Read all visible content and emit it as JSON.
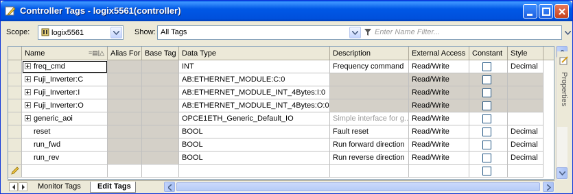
{
  "window": {
    "title": "Controller Tags - logix5561(controller)"
  },
  "toolbar": {
    "scope_label": "Scope:",
    "scope_value": "logix5561",
    "show_label": "Show:",
    "show_value": "All Tags",
    "filter_placeholder": "Enter Name Filter..."
  },
  "table": {
    "columns": [
      "Name",
      "Alias For",
      "Base Tag",
      "Data Type",
      "Description",
      "External Access",
      "Constant",
      "Style"
    ],
    "rows": [
      {
        "name": "freq_cmd",
        "expandable": true,
        "alias_for": "",
        "base_tag": "",
        "data_type": "INT",
        "description": "Frequency command",
        "external_access": "Read/Write",
        "constant": false,
        "style": "Decimal",
        "greyed": false
      },
      {
        "name": "Fuji_Inverter:C",
        "expandable": true,
        "alias_for": "",
        "base_tag": "",
        "data_type": "AB:ETHERNET_MODULE:C:0",
        "description": "",
        "external_access": "Read/Write",
        "constant": false,
        "style": "",
        "greyed": true
      },
      {
        "name": "Fuji_Inverter:I",
        "expandable": true,
        "alias_for": "",
        "base_tag": "",
        "data_type": "AB:ETHERNET_MODULE_INT_4Bytes:I:0",
        "description": "",
        "external_access": "Read/Write",
        "constant": false,
        "style": "",
        "greyed": true
      },
      {
        "name": "Fuji_Inverter:O",
        "expandable": true,
        "alias_for": "",
        "base_tag": "",
        "data_type": "AB:ETHERNET_MODULE_INT_4Bytes:O:0",
        "description": "",
        "external_access": "Read/Write",
        "constant": false,
        "style": "",
        "greyed": true
      },
      {
        "name": "generic_aoi",
        "expandable": true,
        "alias_for": "",
        "base_tag": "",
        "data_type": "OPCE1ETH_Generic_Default_IO",
        "description": "Simple interface for g...",
        "description_muted": true,
        "external_access": "Read/Write",
        "constant": false,
        "style": "",
        "greyed": false
      },
      {
        "name": "reset",
        "expandable": false,
        "alias_for": "",
        "base_tag": "",
        "data_type": "BOOL",
        "description": "Fault reset",
        "external_access": "Read/Write",
        "constant": false,
        "style": "Decimal",
        "greyed": false
      },
      {
        "name": "run_fwd",
        "expandable": false,
        "alias_for": "",
        "base_tag": "",
        "data_type": "BOOL",
        "description": "Run forward direction",
        "external_access": "Read/Write",
        "constant": false,
        "style": "Decimal",
        "greyed": false
      },
      {
        "name": "run_rev",
        "expandable": false,
        "alias_for": "",
        "base_tag": "",
        "data_type": "BOOL",
        "description": "Run reverse direction",
        "external_access": "Read/Write",
        "constant": false,
        "style": "Decimal",
        "greyed": false
      },
      {
        "name": "",
        "expandable": false,
        "alias_for": "",
        "base_tag": "",
        "data_type": "",
        "description": "",
        "external_access": "",
        "constant": false,
        "style": "",
        "greyed": false,
        "new_row": true
      }
    ]
  },
  "side_panel": {
    "label": "Properties"
  },
  "tabs": [
    {
      "label": "Monitor Tags",
      "active": false
    },
    {
      "label": "Edit Tags",
      "active": true
    }
  ],
  "icons": {
    "title": "edit-pencil-icon",
    "scope": "controller-icon",
    "filter": "funnel-icon",
    "new_row": "pencil-icon"
  }
}
